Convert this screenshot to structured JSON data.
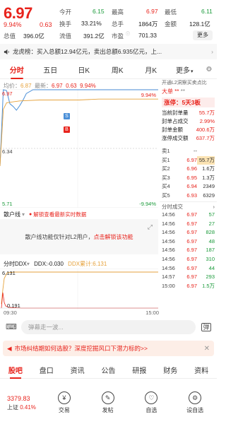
{
  "quote": {
    "price": "6.97",
    "change_pct": "9.94%",
    "change": "0.63",
    "stats": [
      {
        "label": "今开",
        "value": "6.15",
        "color": "green"
      },
      {
        "label": "最高",
        "value": "6.97",
        "color": "red"
      },
      {
        "label": "最低",
        "value": "6.11",
        "color": "green"
      },
      {
        "label": "换手",
        "value": "33.21%",
        "color": "normal"
      },
      {
        "label": "总手",
        "value": "1864万",
        "color": "normal"
      },
      {
        "label": "金额",
        "value": "128.1亿",
        "color": "normal"
      },
      {
        "label": "总值",
        "value": "396.0亿",
        "color": "normal"
      },
      {
        "label": "流值",
        "value": "391.2亿",
        "color": "normal"
      },
      {
        "label": "市盈",
        "value": "701.33",
        "color": "normal"
      }
    ],
    "more_button": "更多"
  },
  "banner": {
    "title": "龙虎榜：",
    "text": "买入总额12.94亿元，卖出总额6.935亿元，上..."
  },
  "tabs": [
    "分时",
    "五日",
    "日K",
    "周K",
    "月K",
    "更多"
  ],
  "chart_info": {
    "avg_label": "均价：",
    "avg_value": "6.87",
    "latest_label": "最新：",
    "latest_value": "6.97",
    "latest_change": "0.63",
    "latest_pct": "9.94%"
  },
  "chart_labels": {
    "top_left": "6.97",
    "mid_left": "6.34",
    "bottom_left": "5.71",
    "top_right": "9.94%",
    "bottom_right": "-9.94%",
    "marker_s": "S",
    "marker_b": "B"
  },
  "chart_data": {
    "type": "line",
    "title": "",
    "series": [
      {
        "name": "",
        "color": "#4a8fd8",
        "x": [
          "09:30",
          "09:35",
          "09:40",
          "09:45",
          "09:50",
          "09:55",
          "10:00",
          "10:05",
          "10:10",
          "10:20",
          "10:30",
          "11:00",
          "11:30",
          "13:30",
          "14:00",
          "15:00"
        ],
        "values": [
          6.15,
          6.97,
          6.96,
          6.82,
          6.79,
          6.75,
          6.8,
          6.86,
          6.93,
          6.97,
          6.97,
          6.97,
          6.97,
          6.97,
          6.97,
          6.97
        ]
      },
      {
        "name": "",
        "color": "#e6a23c",
        "x": [
          "09:30",
          "09:35",
          "09:40",
          "09:50",
          "10:00",
          "10:30",
          "11:30",
          "13:30",
          "14:00",
          "15:00"
        ],
        "values": [
          6.15,
          6.76,
          6.83,
          6.84,
          6.85,
          6.86,
          6.86,
          6.87,
          6.87,
          6.87
        ]
      }
    ],
    "ylim": [
      5.71,
      6.97
    ],
    "reference": 6.34
  },
  "l2": {
    "head": "开通L2洞察买卖点比",
    "title": "大单",
    "limit_label": "涨停：",
    "limit_value": "5天3板",
    "rows": [
      {
        "label": "当前封单量",
        "value": "55.7万"
      },
      {
        "label": "封单占成交",
        "value": "2.99%"
      },
      {
        "label": "封单金额",
        "value": "400.6万"
      },
      {
        "label": "涨停成交额",
        "value": "637.7万"
      }
    ],
    "book": [
      {
        "label": "卖1",
        "price": "--",
        "qty": ""
      },
      {
        "label": "买1",
        "price": "6.97",
        "qty": "55.7万"
      },
      {
        "label": "买2",
        "price": "6.96",
        "qty": "1.6万"
      },
      {
        "label": "买3",
        "price": "6.95",
        "qty": "1.3万"
      },
      {
        "label": "买4",
        "price": "6.94",
        "qty": "2349"
      },
      {
        "label": "买5",
        "price": "6.93",
        "qty": "6329"
      }
    ],
    "deals_title": "分时成交",
    "deals": [
      {
        "time": "14:56",
        "price": "6.97",
        "qty": "57"
      },
      {
        "time": "14:56",
        "price": "6.97",
        "qty": "27"
      },
      {
        "time": "14:56",
        "price": "6.97",
        "qty": "828"
      },
      {
        "time": "14:56",
        "price": "6.97",
        "qty": "48"
      },
      {
        "time": "14:56",
        "price": "6.97",
        "qty": "187"
      },
      {
        "time": "14:56",
        "price": "6.97",
        "qty": "310"
      },
      {
        "time": "14:56",
        "price": "6.97",
        "qty": "44"
      },
      {
        "time": "14:57",
        "price": "6.97",
        "qty": "293"
      },
      {
        "time": "15:00",
        "price": "6.97",
        "qty": "1.5万"
      }
    ]
  },
  "retail": {
    "title": "散户线",
    "lock_text": "解锁查看最新实时数据",
    "box_text": "散户线功能仅针对L2用户，",
    "box_link": "点击解锁该功能"
  },
  "ddx": {
    "title": "分时DDX",
    "ddx_label": "DDX:-0.030",
    "ddx_acc": "DDX累计:6.131",
    "top_value": "6.131",
    "bottom_value": "0.191"
  },
  "time_axis": {
    "start": "09:30",
    "end": "15:00"
  },
  "comment": {
    "placeholder": "弹幕走一波..."
  },
  "promo": {
    "text": "市场纠结期如何选股？深度挖掘风口下潜力标的>>"
  },
  "bottom_tabs": [
    "股吧",
    "盘口",
    "资讯",
    "公告",
    "研报",
    "财务",
    "资料"
  ],
  "footer": {
    "index_value": "3379.83",
    "index_name": "上证",
    "index_pct": "0.41%",
    "buttons": [
      "交易",
      "发帖",
      "自选",
      "设自选"
    ]
  }
}
